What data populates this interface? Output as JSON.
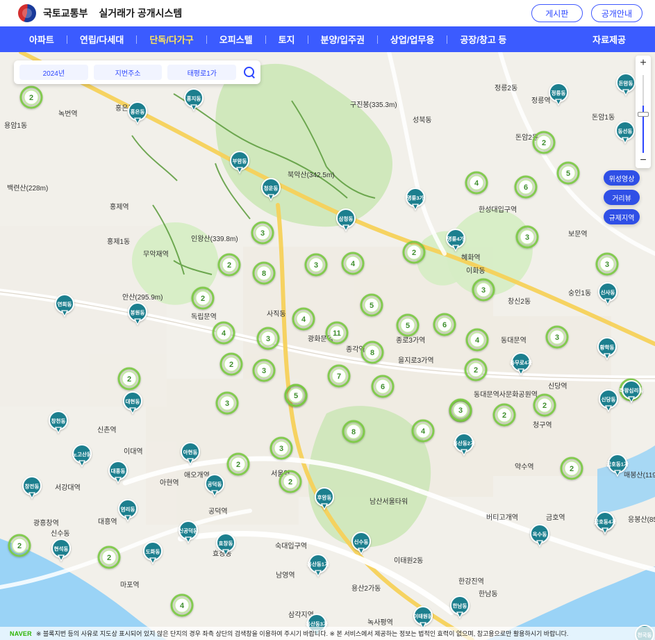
{
  "header": {
    "ministry": "국토교통부",
    "system_title": "실거래가 공개시스템",
    "buttons": [
      {
        "label": "게시판"
      },
      {
        "label": "공개안내"
      }
    ]
  },
  "nav": {
    "items": [
      {
        "label": "아파트"
      },
      {
        "label": "연립/다세대"
      },
      {
        "label": "단독/다가구"
      },
      {
        "label": "오피스텔"
      },
      {
        "label": "토지"
      },
      {
        "label": "분양/입주권"
      },
      {
        "label": "상업/업무용"
      },
      {
        "label": "공장/창고 등"
      }
    ],
    "right": {
      "label": "자료제공"
    }
  },
  "search": {
    "year": "2024년",
    "address_type": "지번주소",
    "road": "태평로1가"
  },
  "map_controls": {
    "zoom_in": "+",
    "zoom_out": "−",
    "buttons": [
      {
        "label": "위성영상"
      },
      {
        "label": "거리뷰"
      },
      {
        "label": "규제지역"
      }
    ],
    "zoom_level_fraction": 0.55
  },
  "notice": {
    "brand": "NAVER",
    "text": "※ 블록지번 등의 사유로 지도상 표시되어 있지 않은 단지의 경우 좌측 상단의 검색창을 이용하여 주시기 바랍니다. ※ 본 서비스에서 제공하는 정보는 법적인 효력이 없으며, 참고용으로만 활용하시기 바랍니다."
  },
  "map": {
    "colors": {
      "background": "#f2f0ea",
      "water": "#9ad3f6",
      "park": "#cde7b9",
      "road": "#ffffff",
      "highway": "#f6d15a",
      "trail": "#5a9b3b",
      "cluster_fill": "#ffffff",
      "cluster_ring": "#7ac943",
      "pin_fill": "#1d7f8e"
    },
    "labels": [
      {
        "text": "용암1동"
      },
      {
        "text": "녹번역"
      },
      {
        "text": "홍은동"
      },
      {
        "text": "홍제역"
      },
      {
        "text": "홍제1동"
      },
      {
        "text": "무악재역"
      },
      {
        "text": "독립문역"
      },
      {
        "text": "사직동"
      },
      {
        "text": "광화문역"
      },
      {
        "text": "종각역"
      },
      {
        "text": "을지로3가역"
      },
      {
        "text": "종로3가역"
      },
      {
        "text": "동대문역"
      },
      {
        "text": "동대문역사문화공원역"
      },
      {
        "text": "신당역"
      },
      {
        "text": "청구역"
      },
      {
        "text": "약수역"
      },
      {
        "text": "버티고개역"
      },
      {
        "text": "금호역"
      },
      {
        "text": "남산서울타워"
      },
      {
        "text": "서울역"
      },
      {
        "text": "숙대입구역"
      },
      {
        "text": "남영역"
      },
      {
        "text": "삼각지역"
      },
      {
        "text": "녹사평역"
      },
      {
        "text": "이태원2동"
      },
      {
        "text": "한강진역"
      },
      {
        "text": "한남동"
      },
      {
        "text": "용산2가동"
      },
      {
        "text": "효창동"
      },
      {
        "text": "마포역"
      },
      {
        "text": "공덕역"
      },
      {
        "text": "애오개역"
      },
      {
        "text": "아현역"
      },
      {
        "text": "이대역"
      },
      {
        "text": "신촌역"
      },
      {
        "text": "서강대역"
      },
      {
        "text": "대흥역"
      },
      {
        "text": "광흥창역"
      },
      {
        "text": "신수동"
      },
      {
        "text": "한성대입구역"
      },
      {
        "text": "혜화역"
      },
      {
        "text": "이화동"
      },
      {
        "text": "창신2동"
      },
      {
        "text": "숭인1동"
      },
      {
        "text": "보문역"
      },
      {
        "text": "성북동"
      },
      {
        "text": "정릉2동"
      },
      {
        "text": "정릉역"
      },
      {
        "text": "돈암2동"
      },
      {
        "text": "돈암1동"
      },
      {
        "text": "북악산(342.5m)"
      },
      {
        "text": "인왕산(339.8m)"
      },
      {
        "text": "구진봉(335.3m)"
      },
      {
        "text": "백련산(228m)"
      },
      {
        "text": "안산(295.9m)"
      },
      {
        "text": "응봉산(85.4m)"
      },
      {
        "text": "매봉산(119.2m)"
      }
    ],
    "clusters": [
      {
        "count": 2
      },
      {
        "count": 3
      },
      {
        "count": 8
      },
      {
        "count": 3
      },
      {
        "count": 2
      },
      {
        "count": 2
      },
      {
        "count": 4
      },
      {
        "count": 3
      },
      {
        "count": 4
      },
      {
        "count": 2
      },
      {
        "count": 4
      },
      {
        "count": 2
      },
      {
        "count": 5
      },
      {
        "count": 3
      },
      {
        "count": 6
      },
      {
        "count": 3
      },
      {
        "count": 5
      },
      {
        "count": 8
      },
      {
        "count": 7
      },
      {
        "count": 5
      },
      {
        "count": 6
      },
      {
        "count": 11
      },
      {
        "count": 8
      },
      {
        "count": 2
      },
      {
        "count": 3
      },
      {
        "count": 5
      },
      {
        "count": 3
      },
      {
        "count": 4
      },
      {
        "count": 2
      },
      {
        "count": 2
      },
      {
        "count": 3
      },
      {
        "count": 2
      },
      {
        "count": 4
      },
      {
        "count": 3
      },
      {
        "count": 2
      },
      {
        "count": 2
      },
      {
        "count": 6
      },
      {
        "count": 4
      },
      {
        "count": 3
      },
      {
        "count": 5
      },
      {
        "count": 2
      },
      {
        "count": 3
      },
      {
        "count": 4
      },
      {
        "count": 2
      },
      {
        "count": 2
      },
      {
        "count": 3
      },
      {
        "count": 2
      },
      {
        "count": 2
      }
    ],
    "pins": [
      {
        "label": "홍은동"
      },
      {
        "label": "홍지동"
      },
      {
        "label": "부암동"
      },
      {
        "label": "청운동"
      },
      {
        "label": "삼청동"
      },
      {
        "label": "명륜3가"
      },
      {
        "label": "명륜4가"
      },
      {
        "label": "정릉동"
      },
      {
        "label": "돈암동"
      },
      {
        "label": "연희동"
      },
      {
        "label": "봉원동"
      },
      {
        "label": "대현동"
      },
      {
        "label": "창천동"
      },
      {
        "label": "노고산동"
      },
      {
        "label": "대흥동"
      },
      {
        "label": "창전동"
      },
      {
        "label": "염리동"
      },
      {
        "label": "아현동"
      },
      {
        "label": "공덕동"
      },
      {
        "label": "도화동"
      },
      {
        "label": "현석동"
      },
      {
        "label": "신공덕동"
      },
      {
        "label": "효창동"
      },
      {
        "label": "후암동"
      },
      {
        "label": "용산동2가"
      },
      {
        "label": "이태원동"
      },
      {
        "label": "한남동"
      },
      {
        "label": "신당동"
      },
      {
        "label": "신사동"
      },
      {
        "label": "용산동3가"
      },
      {
        "label": "용산동1가"
      },
      {
        "label": "신수동"
      },
      {
        "label": "충무로4가"
      },
      {
        "label": "동선동"
      },
      {
        "label": "황학동"
      },
      {
        "label": "옥수동"
      },
      {
        "label": "응봉동"
      },
      {
        "label": "금호동1가"
      },
      {
        "label": "금호동4가"
      },
      {
        "label": "하왕십리동"
      },
      {
        "label": "천국동"
      }
    ]
  }
}
